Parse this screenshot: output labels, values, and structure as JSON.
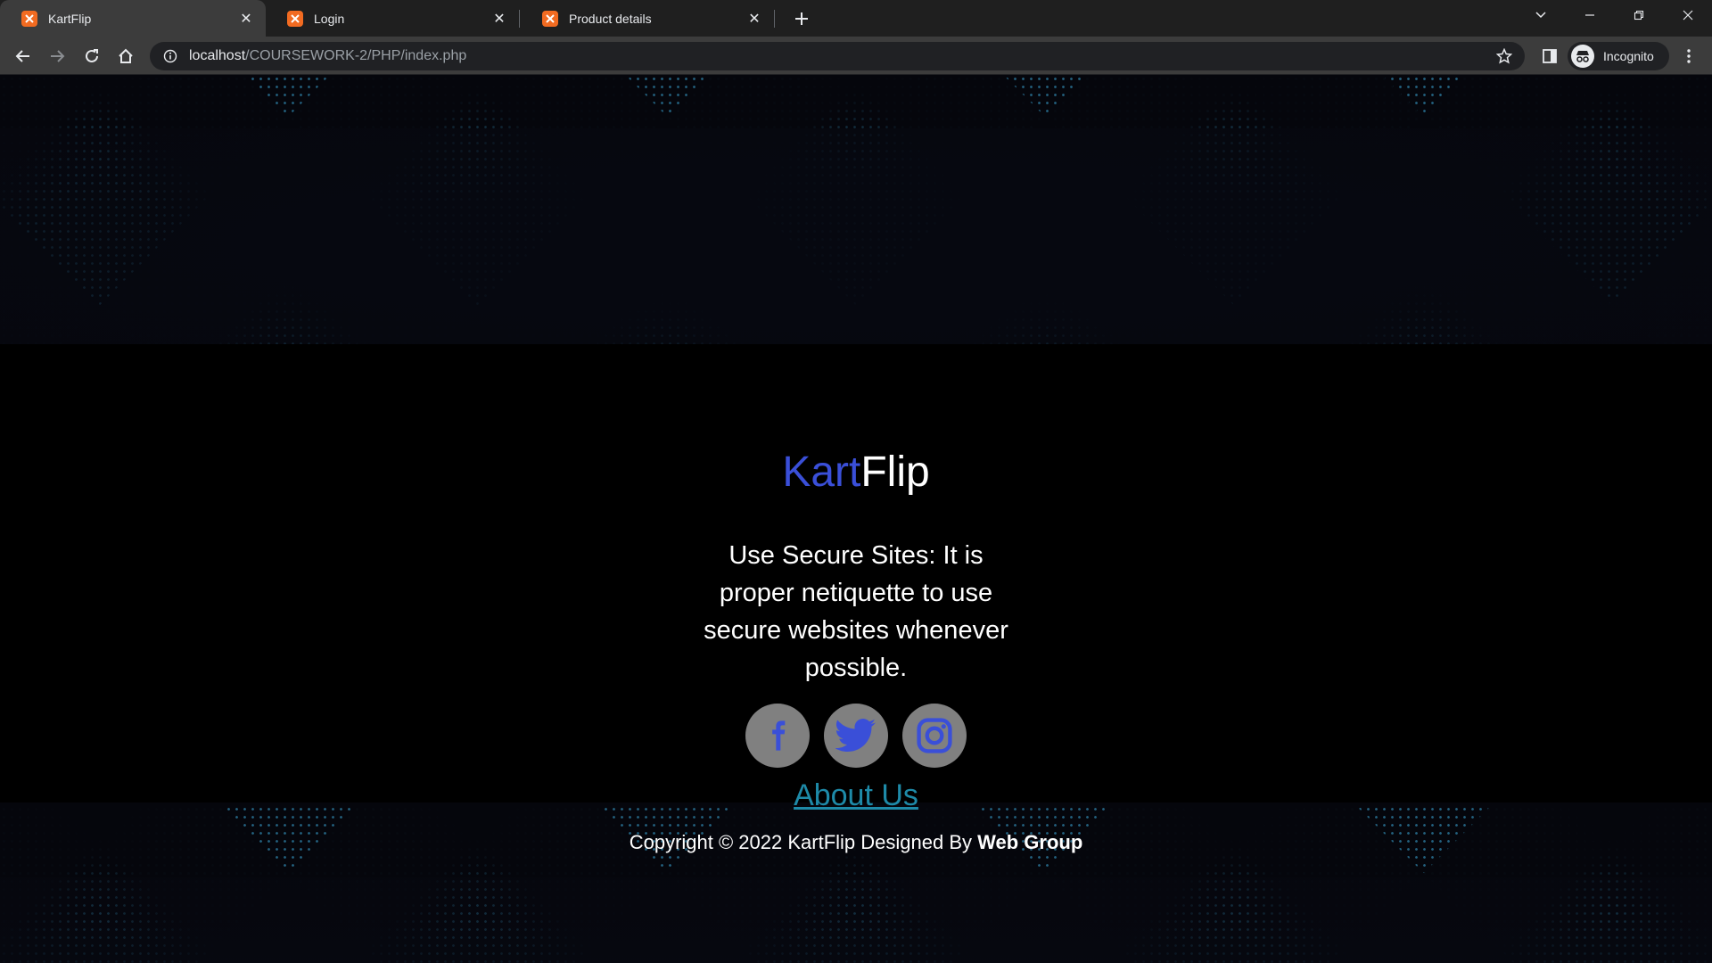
{
  "browser": {
    "tabs": [
      {
        "title": "KartFlip",
        "active": true
      },
      {
        "title": "Login",
        "active": false
      },
      {
        "title": "Product details",
        "active": false
      }
    ],
    "url_host": "localhost",
    "url_path": "/COURSEWORK-2/PHP/index.php",
    "profile_label": "Incognito",
    "colors": {
      "tab_bar": "#1f1f1f",
      "toolbar": "#3c3c3c",
      "favicon": "#f26b21"
    }
  },
  "page": {
    "brand_part1": "Kart",
    "brand_part2": "Flip",
    "tip": "Use Secure Sites: It is proper netiquette to use secure websites whenever possible.",
    "socials": [
      {
        "icon": "facebook-icon"
      },
      {
        "icon": "twitter-icon"
      },
      {
        "icon": "instagram-icon"
      }
    ],
    "about_link": "About Us",
    "copyright_prefix": "Copyright © 2022 KartFlip Designed By ",
    "copyright_author": "Web Group",
    "colors": {
      "brand_accent": "#3a4fd8",
      "social_bg": "#808080",
      "social_icon": "#3a4fd8",
      "link": "#1e8aa8",
      "footer_bg": "#000000"
    }
  }
}
